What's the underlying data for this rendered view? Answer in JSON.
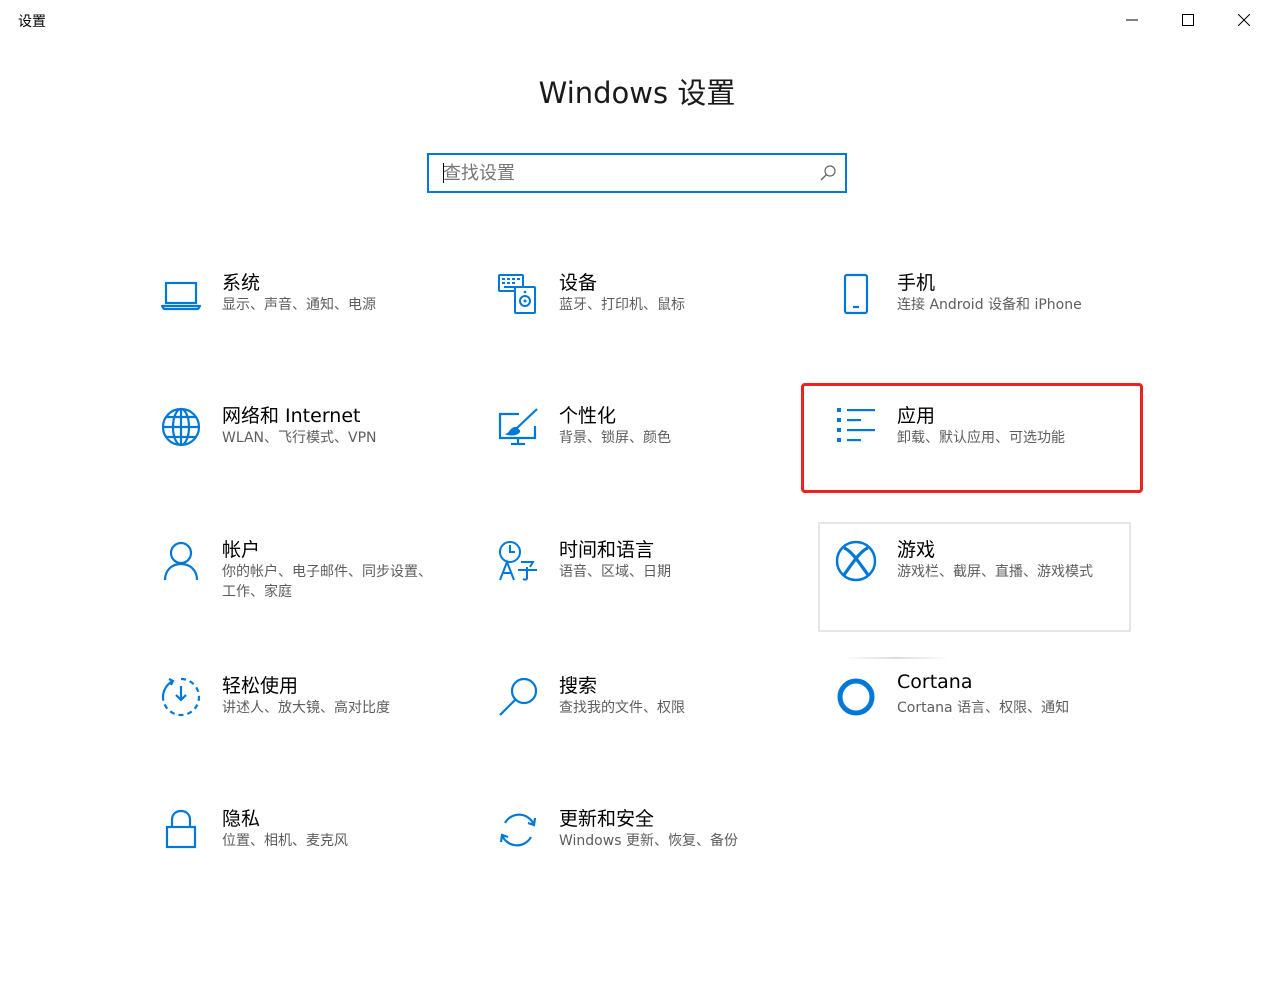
{
  "window": {
    "title": "设置",
    "controls": {
      "minimize": "minimize-icon",
      "maximize": "maximize-icon",
      "close": "close-icon"
    }
  },
  "page": {
    "title": "Windows 设置"
  },
  "search": {
    "placeholder": "查找设置",
    "value": "",
    "icon": "search-icon"
  },
  "theme": {
    "accent": "#0078d7",
    "highlight": "#f02020"
  },
  "tiles": [
    {
      "id": "system",
      "title": "系统",
      "desc": "显示、声音、通知、电源",
      "icon": "laptop-icon"
    },
    {
      "id": "devices",
      "title": "设备",
      "desc": "蓝牙、打印机、鼠标",
      "icon": "devices-icon"
    },
    {
      "id": "phone",
      "title": "手机",
      "desc": "连接 Android 设备和 iPhone",
      "icon": "phone-icon"
    },
    {
      "id": "network",
      "title": "网络和 Internet",
      "desc": "WLAN、飞行模式、VPN",
      "icon": "globe-icon"
    },
    {
      "id": "personalization",
      "title": "个性化",
      "desc": "背景、锁屏、颜色",
      "icon": "paint-icon"
    },
    {
      "id": "apps",
      "title": "应用",
      "desc": "卸载、默认应用、可选功能",
      "icon": "apps-list-icon"
    },
    {
      "id": "accounts",
      "title": "帐户",
      "desc": "你的帐户、电子邮件、同步设置、工作、家庭",
      "icon": "person-icon"
    },
    {
      "id": "time-language",
      "title": "时间和语言",
      "desc": "语音、区域、日期",
      "icon": "time-language-icon"
    },
    {
      "id": "gaming",
      "title": "游戏",
      "desc": "游戏栏、截屏、直播、游戏模式",
      "icon": "xbox-icon"
    },
    {
      "id": "ease-of-access",
      "title": "轻松使用",
      "desc": "讲述人、放大镜、高对比度",
      "icon": "ease-of-access-icon"
    },
    {
      "id": "search",
      "title": "搜索",
      "desc": "查找我的文件、权限",
      "icon": "magnifier-icon"
    },
    {
      "id": "cortana",
      "title": "Cortana",
      "desc": "Cortana 语言、权限、通知",
      "icon": "cortana-icon"
    },
    {
      "id": "privacy",
      "title": "隐私",
      "desc": "位置、相机、麦克风",
      "icon": "lock-icon"
    },
    {
      "id": "update-security",
      "title": "更新和安全",
      "desc": "Windows 更新、恢复、备份",
      "icon": "sync-icon"
    }
  ]
}
